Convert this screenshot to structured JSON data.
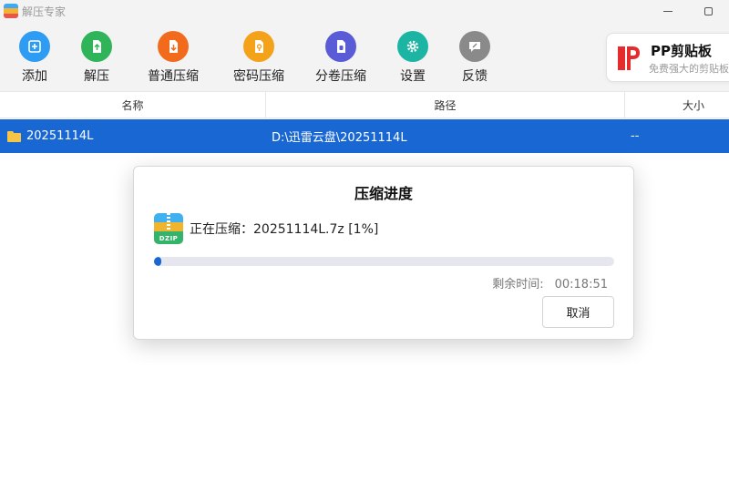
{
  "window": {
    "title": "解压专家"
  },
  "toolbar": {
    "items": [
      {
        "label": "添加",
        "icon": "plus-icon",
        "color": "#2f9cf4"
      },
      {
        "label": "解压",
        "icon": "extract-icon",
        "color": "#2fb45a"
      },
      {
        "label": "普通压缩",
        "icon": "compress-icon",
        "color": "#f26b1d"
      },
      {
        "label": "密码压缩",
        "icon": "password-compress-icon",
        "color": "#f5a21b"
      },
      {
        "label": "分卷压缩",
        "icon": "split-compress-icon",
        "color": "#5a5bd6"
      },
      {
        "label": "设置",
        "icon": "gear-icon",
        "color": "#1cb5a3"
      },
      {
        "label": "反馈",
        "icon": "feedback-icon",
        "color": "#8a8a8a"
      }
    ]
  },
  "ad": {
    "title": "PP剪贴板",
    "subtitle": "免费强大的剪贴板"
  },
  "table": {
    "columns": {
      "name": "名称",
      "path": "路径",
      "size": "大小"
    },
    "rows": [
      {
        "name": "20251114L",
        "path": "D:\\迅雷云盘\\20251114L",
        "size": "--"
      }
    ]
  },
  "dialog": {
    "title": "压缩进度",
    "icon_label": "DZIP",
    "status": "正在压缩：20251114L.7z   [1%]",
    "progress_percent": 1,
    "remaining_label": "剩余时间:",
    "remaining_value": "00:18:51",
    "cancel_label": "取消"
  },
  "colors": {
    "accent": "#1967d2",
    "toolbar_bg": "#f3f3f3"
  }
}
